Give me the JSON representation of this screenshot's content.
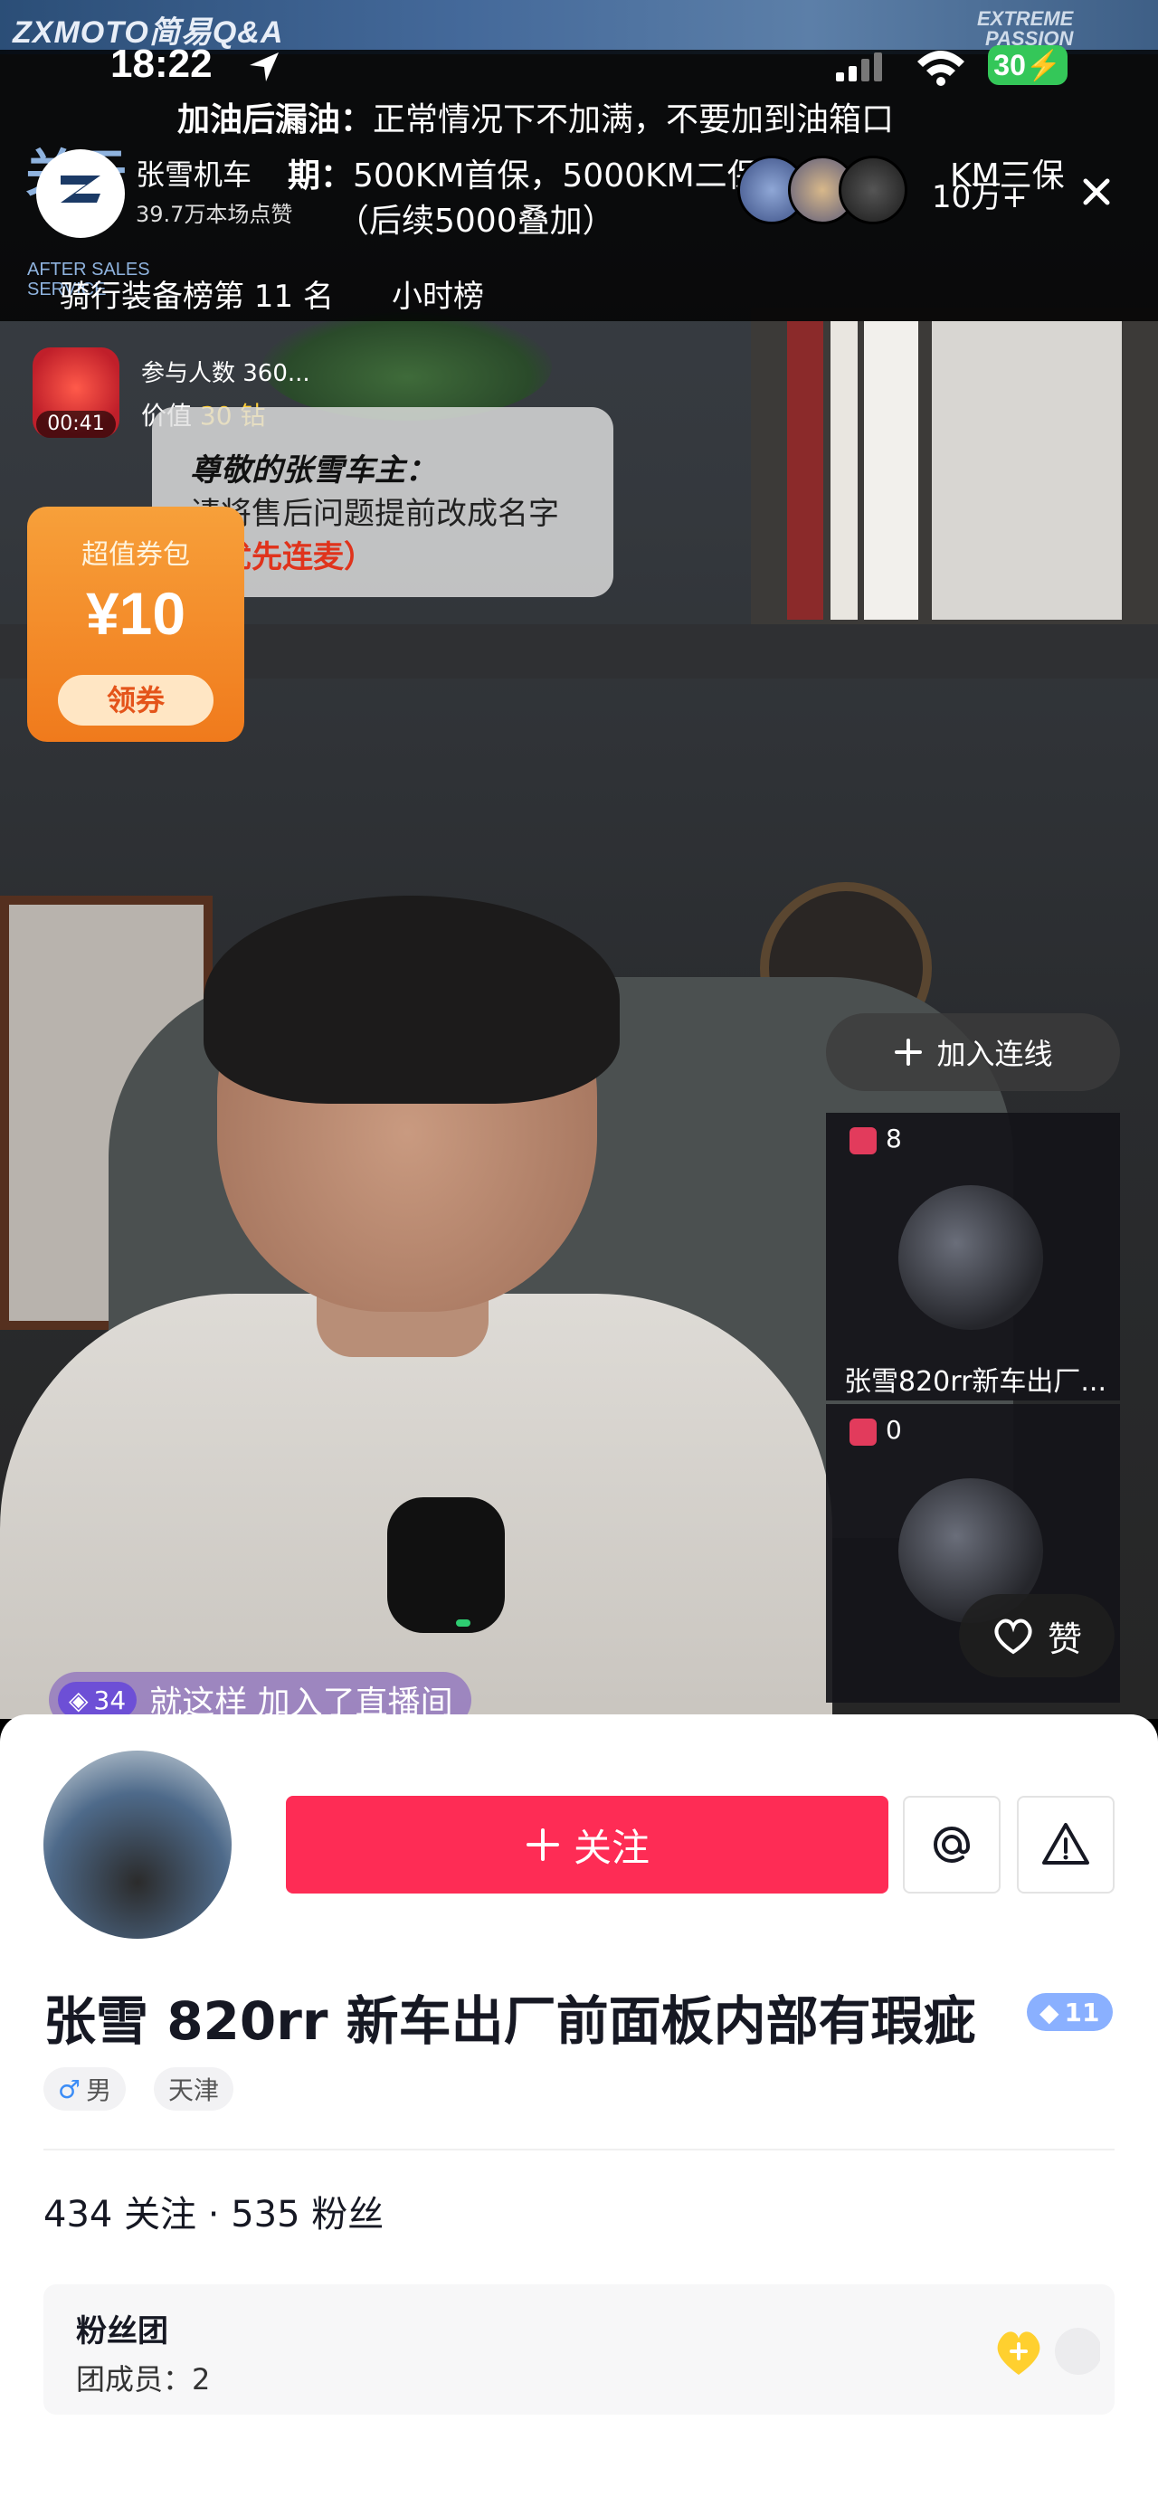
{
  "status_bar": {
    "time": "18:22",
    "battery": "30"
  },
  "banner": {
    "brand": "ZXMOTO简易Q&A",
    "brand_right_1": "EXTREME",
    "brand_right_2": "PASSION",
    "side_title": "关于",
    "side_small_1": "AFTER SALES",
    "side_small_2": "SERVICE",
    "line1_key": "加油后漏油：",
    "line1_value": "正常情况下不加满，不要加到油箱口",
    "line2_key": "期：",
    "line2_value": "500KM首保，5000KM二保",
    "line2_tail": "KM三保",
    "line3": "（后续5000叠加）"
  },
  "host": {
    "name": "张雪机车",
    "likes": "39.7万本场点赞",
    "viewer_count": "10万+"
  },
  "tags": {
    "rank": "骑行装备榜第 11 名",
    "hour": "小时榜"
  },
  "lucky_bag": {
    "timer": "00:41",
    "count": "参与人数 360...",
    "value_label": "价值",
    "value": "30 钻"
  },
  "message": {
    "title": "尊敬的张雪车主：",
    "line1": "请将售后问题提前改成名字",
    "line2": "会优先连麦）"
  },
  "coupon": {
    "title": "超值券包",
    "amount": "¥10",
    "button": "领券"
  },
  "join_button": "加入连线",
  "cohosts": [
    {
      "gifts": "8",
      "name": "张雪820rr新车出厂..."
    },
    {
      "gifts": "0",
      "name": ""
    }
  ],
  "like_button": "赞",
  "join_message": {
    "level": "34",
    "text": "就这样 加入了直播间"
  },
  "profile": {
    "follow": "关注",
    "name": "张雪 820rr 新车出厂前面板内部有瑕疵",
    "fan_level": "11",
    "gender": "男",
    "city": "天津",
    "stats": "434 关注 · 535 粉丝",
    "fan_club_title": "粉丝团",
    "fan_club_members": "团成员：2"
  },
  "colors": {
    "follow": "#fe2c55",
    "coupon": "#f07a1c",
    "battery": "#34c759"
  }
}
